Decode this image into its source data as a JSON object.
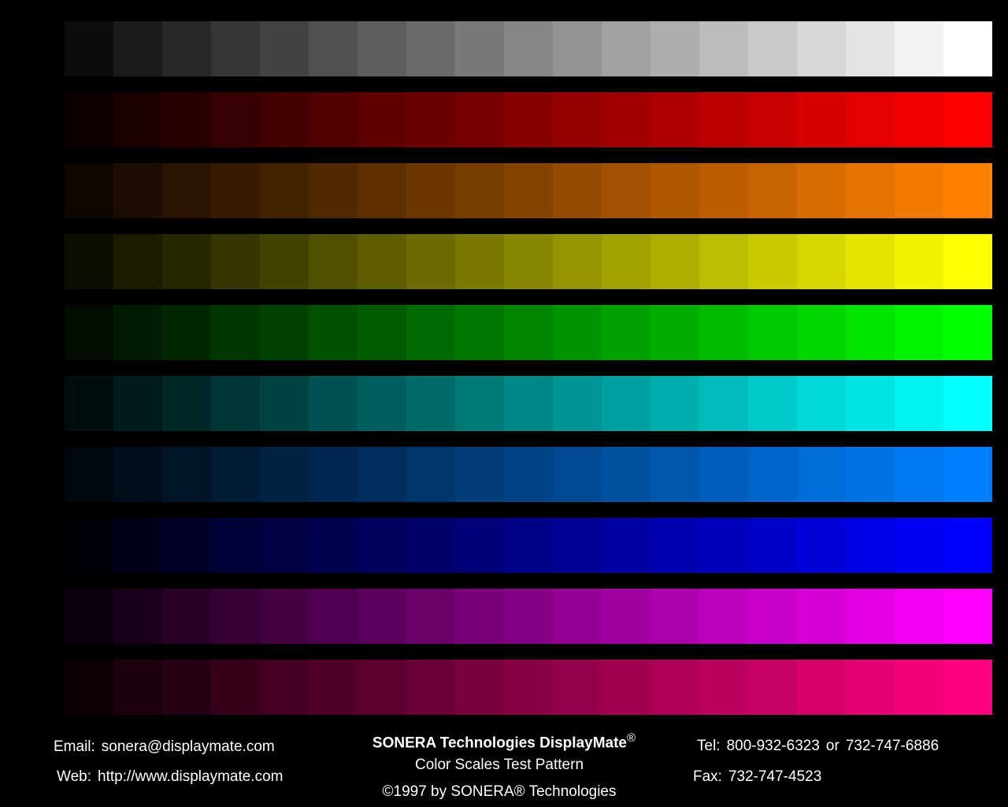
{
  "scales": {
    "steps": 19,
    "rows": [
      {
        "name": "gray",
        "color": "#ffffff"
      },
      {
        "name": "red",
        "color": "#ff0000"
      },
      {
        "name": "orange",
        "color": "#ff8000"
      },
      {
        "name": "yellow",
        "color": "#ffff00"
      },
      {
        "name": "green",
        "color": "#00ff00"
      },
      {
        "name": "cyan",
        "color": "#00ffff"
      },
      {
        "name": "azure",
        "color": "#0080ff"
      },
      {
        "name": "blue",
        "color": "#0000ff"
      },
      {
        "name": "magenta",
        "color": "#ff00ff"
      },
      {
        "name": "rose",
        "color": "#ff0080"
      }
    ]
  },
  "footer": {
    "email_label": "Email:",
    "email_value": "sonera@displaymate.com",
    "web_label": "Web:",
    "web_value": "http://www.displaymate.com",
    "brand": "SONERA Technologies DisplayMate",
    "registered_mark": "®",
    "pattern_name": "Color Scales Test Pattern",
    "copyright_symbol": "©",
    "copyright_text_a": "1997 by SONERA",
    "copyright_text_b": " Technologies",
    "tel_label": "Tel:",
    "tel_value_1": "800-932-6323",
    "tel_or": "or",
    "tel_value_2": "732-747-6886",
    "fax_label": "Fax:",
    "fax_value": "732-747-4523"
  }
}
